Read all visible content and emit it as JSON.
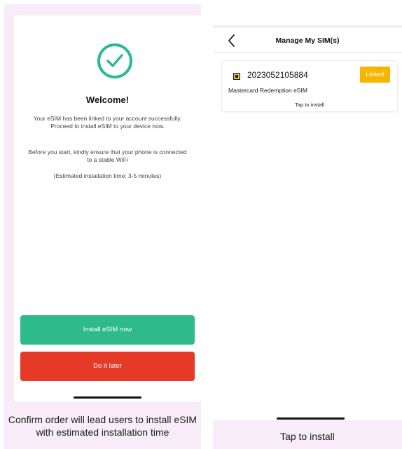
{
  "welcome_screen": {
    "title": "Welcome!",
    "message": "Your eSIM has been linked to your account successfully. Proceed to install eSIM to your device now.",
    "wifi_note": "Before you start, kindly ensure that your phone is connected to a stable WiFi",
    "estimate": "(Estimated installation time: 3-5 minutes)",
    "install_button": "Install eSIM now",
    "later_button": "Do it later",
    "caption": "Confirm order will lead users to install eSIM with estimated installation time"
  },
  "manage_screen": {
    "title": "Manage My SIM(s)",
    "sim": {
      "number": "2023052105884",
      "status": "Linked",
      "name": "Mastercard Redemption eSIM",
      "hint": "Tap to install"
    },
    "caption": "Tap to install"
  },
  "colors": {
    "accent_green": "#2eba8a",
    "danger_red": "#e63a28",
    "badge_yellow": "#f6b500",
    "panel_pink": "#f7ecf8"
  },
  "icons": [
    "checkmark-icon",
    "back-chevron-icon",
    "sim-card-icon"
  ]
}
